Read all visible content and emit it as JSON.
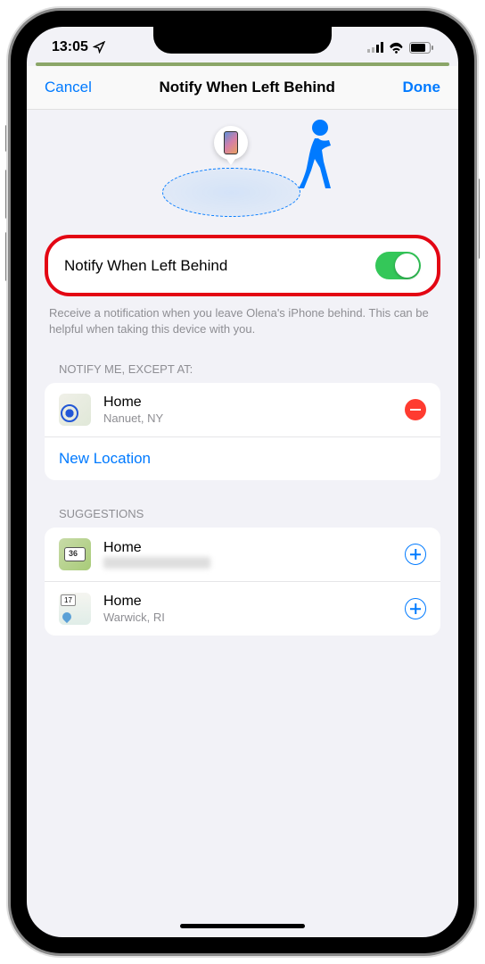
{
  "status": {
    "time": "13:05"
  },
  "nav": {
    "cancel": "Cancel",
    "title": "Notify When Left Behind",
    "done": "Done"
  },
  "toggle": {
    "label": "Notify When Left Behind",
    "enabled": true
  },
  "description": "Receive a notification when you leave Olena's iPhone behind. This can be helpful when taking this device with you.",
  "exceptions": {
    "header": "NOTIFY ME, EXCEPT AT:",
    "items": [
      {
        "title": "Home",
        "subtitle": "Nanuet, NY"
      }
    ],
    "new_location": "New Location"
  },
  "suggestions": {
    "header": "SUGGESTIONS",
    "items": [
      {
        "title": "Home",
        "subtitle": ""
      },
      {
        "title": "Home",
        "subtitle": "Warwick, RI"
      }
    ]
  }
}
